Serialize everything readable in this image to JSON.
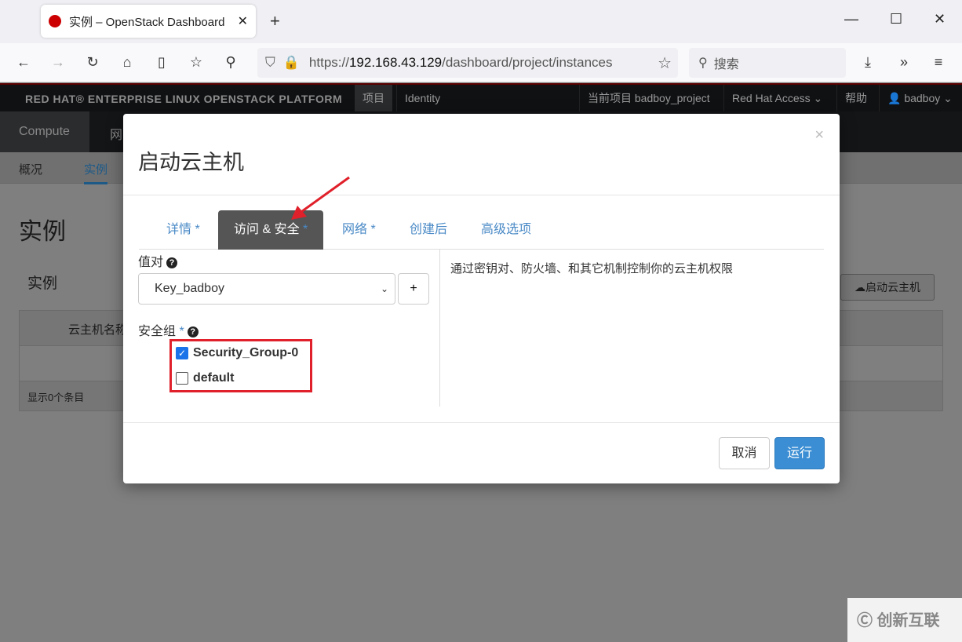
{
  "browser": {
    "tab_title": "实例 – OpenStack Dashboard",
    "url_prefix": "https://",
    "url_host": "192.168.43.129",
    "url_path": "/dashboard/project/instances",
    "search_placeholder": "搜索"
  },
  "topnav": {
    "brand": "RED HAT® ENTERPRISE LINUX OPENSTACK PLATFORM",
    "project_tab": "项目",
    "identity_tab": "Identity",
    "current_project": "当前项目 badboy_project",
    "rh_access": "Red Hat Access ⌄",
    "help": "帮助",
    "user": "badboy ⌄"
  },
  "subnav": {
    "compute": "Compute",
    "network": "网",
    "overview": "概况",
    "instances": "实例"
  },
  "page": {
    "title": "实例",
    "section": "实例",
    "launch_button": "启动云主机",
    "col_name": "云主机名称",
    "footer": "显示0个条目"
  },
  "modal": {
    "title": "启动云主机",
    "close": "×",
    "tabs": [
      {
        "label": "详情",
        "star": " *"
      },
      {
        "label": "访问 & 安全",
        "star": " *"
      },
      {
        "label": "网络",
        "star": " *"
      },
      {
        "label": "创建后",
        "star": ""
      },
      {
        "label": "高级选项",
        "star": ""
      }
    ],
    "keypair_label": "值对",
    "keypair_value": "Key_badboy",
    "add": "+",
    "secgroup_label": "安全组",
    "required": " *",
    "groups": [
      {
        "name": "Security_Group-0",
        "checked": true
      },
      {
        "name": "default",
        "checked": false
      }
    ],
    "help_text": "通过密钥对、防火墙、和其它机制控制你的云主机权限",
    "cancel": "取消",
    "run": "运行"
  },
  "watermark": "创新互联"
}
